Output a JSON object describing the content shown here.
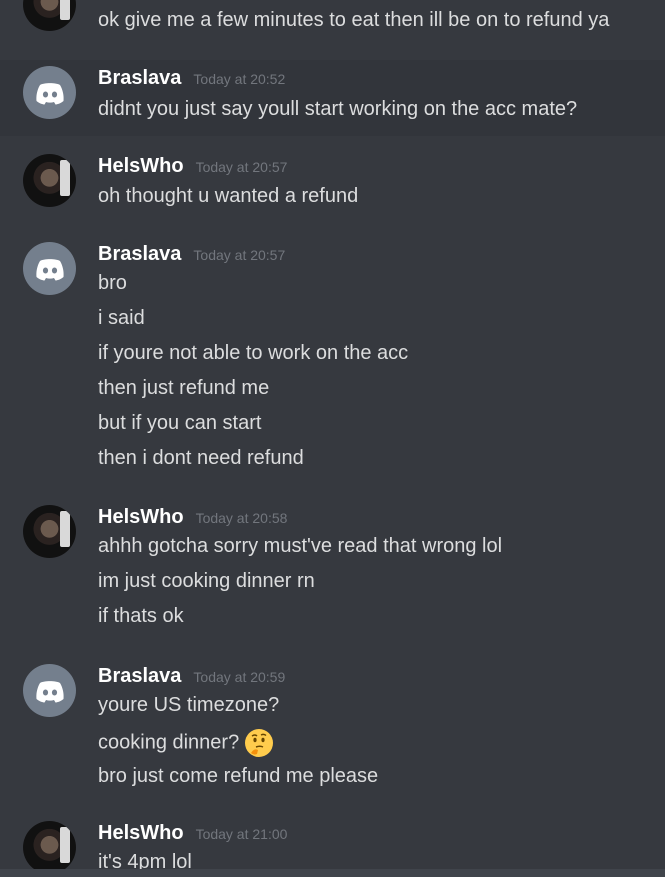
{
  "messages": [
    {
      "author": "",
      "timestamp": "",
      "lines": [
        "ok give me a few minutes to eat then ill be on to refund ya"
      ]
    },
    {
      "author": "Braslava",
      "timestamp": "Today at 20:52",
      "lines": [
        "didnt you just say youll start working on the acc mate?"
      ]
    },
    {
      "author": "HelsWho",
      "timestamp": "Today at 20:57",
      "lines": [
        "oh thought u wanted a refund"
      ]
    },
    {
      "author": "Braslava",
      "timestamp": "Today at 20:57",
      "lines": [
        "bro",
        "i said",
        "if youre not able to work on the acc",
        "then just refund me",
        "but if you can start",
        "then i dont need refund"
      ]
    },
    {
      "author": "HelsWho",
      "timestamp": "Today at 20:58",
      "lines": [
        "ahhh gotcha sorry must've read that wrong lol",
        "im just cooking dinner rn",
        "if thats ok"
      ]
    },
    {
      "author": "Braslava",
      "timestamp": "Today at 20:59",
      "lines": [
        "youre US timezone?",
        "cooking dinner?",
        "bro just come refund me please"
      ],
      "emoji": "thinking-face"
    },
    {
      "author": "HelsWho",
      "timestamp": "Today at 21:00",
      "lines": [
        "it's 4pm lol"
      ]
    }
  ],
  "icons": {
    "discord_avatar": "discord-logo-icon",
    "user_avatar": "user-photo-avatar",
    "thinking": "thinking-face-emoji"
  },
  "colors": {
    "background": "#36393f",
    "hover_background": "#32353b",
    "username": "#ffffff",
    "text": "#dcddde",
    "timestamp": "#72767d",
    "default_avatar": "#747f8d"
  }
}
